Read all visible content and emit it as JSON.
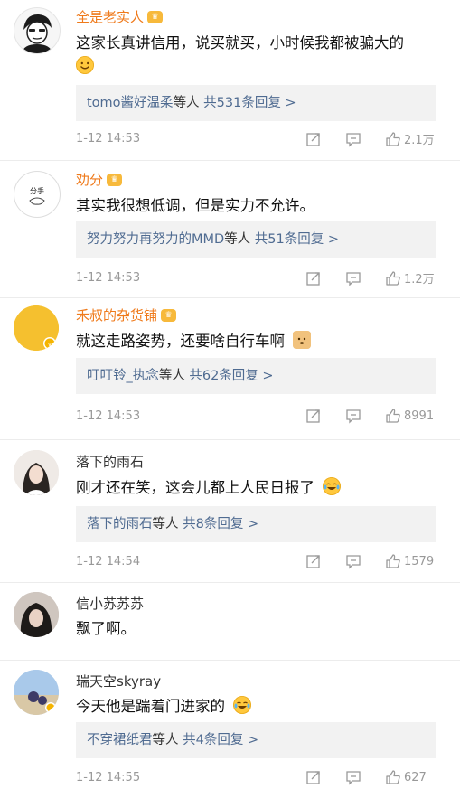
{
  "comments": [
    {
      "name": "全是老实人",
      "vip": true,
      "text": "这家长真讲信用，说买就买，小时候我都被骗大的",
      "text2": "",
      "reply": {
        "who": "tomo酱好温柔",
        "etc": "等人",
        "count": "共531条回复 >"
      },
      "time": "1-12 14:53",
      "likes": "2.1万",
      "avatar_color": "#f3f3f3"
    },
    {
      "name": "劝分",
      "vip": true,
      "avatar_text": "分手",
      "text": "其实我很想低调，但是实力不允许。",
      "reply": {
        "who": "努力努力再努力的MMD",
        "etc": "等人",
        "count": "共51条回复 >"
      },
      "time": "1-12 14:53",
      "likes": "1.2万",
      "avatar_color": "#ffffff"
    },
    {
      "name": "禾叔的杂货铺",
      "vip": true,
      "text": "就这走路姿势，还要啥自行车啊",
      "reply": {
        "who": "叮叮铃_执念",
        "etc": "等人",
        "count": "共62条回复 >"
      },
      "time": "1-12 14:53",
      "likes": "8991",
      "avatar_color": "#f5c02f"
    },
    {
      "name": "落下的雨石",
      "vip": false,
      "text": "刚才还在笑，这会儿都上人民日报了",
      "reply": {
        "who": "落下的雨石",
        "etc": "等人",
        "count": "共8条回复 >"
      },
      "time": "1-12 14:54",
      "likes": "1579",
      "avatar_color": "#e8e2dd"
    },
    {
      "name": "信小苏苏苏",
      "vip": false,
      "text": "飘了啊。",
      "avatar_color": "#c9bfb8"
    },
    {
      "name": "瑞天空skyray",
      "vip": false,
      "text": "今天他是踹着门进家的",
      "reply": {
        "who": "不穿裙纸君",
        "etc": "等人",
        "count": "共4条回复 >"
      },
      "time": "1-12 14:55",
      "likes": "627",
      "avatar_color": "#bcd4ea"
    }
  ]
}
